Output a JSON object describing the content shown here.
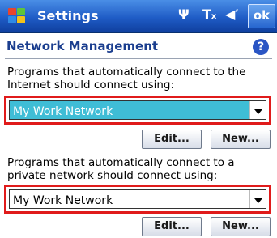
{
  "titlebar": {
    "title": "Settings",
    "ok_label": "ok",
    "tray_icons": [
      "antenna-icon",
      "signal-off-icon",
      "volume-icon"
    ]
  },
  "header": {
    "title": "Network Management",
    "help_label": "?"
  },
  "internet": {
    "description": "Programs that automatically connect to the Internet should connect using:",
    "selected_value": "My Work Network",
    "edit_label": "Edit...",
    "new_label": "New..."
  },
  "private": {
    "description": "Programs that automatically connect to a private network should connect using:",
    "selected_value": "My Work Network",
    "edit_label": "Edit...",
    "new_label": "New..."
  },
  "colors": {
    "titlebar": "#1f5cc6",
    "highlight_border": "#e01b1b",
    "selected_combo": "#3fbdd6",
    "section_title": "#1b3e8f"
  }
}
